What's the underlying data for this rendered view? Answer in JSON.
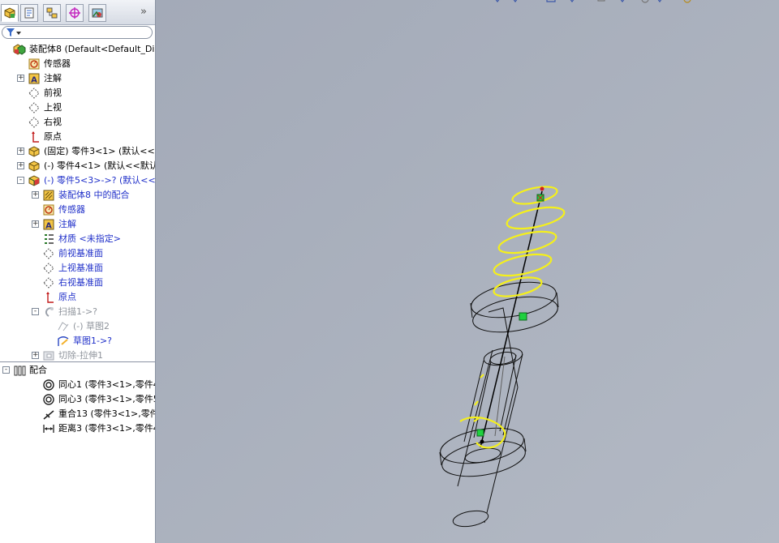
{
  "colors": {
    "viewport_bg": "#a7aebb",
    "spring": "#f5f01a",
    "selected_text": "#1f2fc9",
    "mate_point": "#1fd13f"
  },
  "tabs": [
    {
      "icon": "feature-manager-icon",
      "active": true
    },
    {
      "icon": "property-manager-icon",
      "active": false
    },
    {
      "icon": "configuration-manager-icon",
      "active": false
    },
    {
      "icon": "dimxpert-manager-icon",
      "active": false
    },
    {
      "icon": "display-manager-icon",
      "active": false
    }
  ],
  "more_label": "»",
  "tree": [
    {
      "label": "装配体8  (Default<Default_Di",
      "icon": "assembly-icon",
      "level": 0,
      "expander": ""
    },
    {
      "label": "传感器",
      "icon": "sensor-icon",
      "level": 1,
      "expander": ""
    },
    {
      "label": "注解",
      "icon": "annotation-icon",
      "level": 1,
      "expander": "+"
    },
    {
      "label": "前视",
      "icon": "plane-icon",
      "level": 1,
      "expander": ""
    },
    {
      "label": "上视",
      "icon": "plane-icon",
      "level": 1,
      "expander": ""
    },
    {
      "label": "右视",
      "icon": "plane-icon",
      "level": 1,
      "expander": ""
    },
    {
      "label": "原点",
      "icon": "origin-icon",
      "level": 1,
      "expander": ""
    },
    {
      "label": "(固定) 零件3<1> (默认<<默",
      "icon": "part-icon",
      "level": 1,
      "expander": "+"
    },
    {
      "label": "(-) 零件4<1> (默认<<默认>",
      "icon": "part-icon",
      "level": 1,
      "expander": "+"
    },
    {
      "label": "(-) 零件5<3>->? (默认<<默",
      "icon": "part-edit-icon",
      "level": 1,
      "expander": "-",
      "style": "blue"
    },
    {
      "label": "装配体8 中的配合",
      "icon": "mates-in-assembly-icon",
      "level": 2,
      "expander": "+",
      "style": "blue"
    },
    {
      "label": "传感器",
      "icon": "sensor-icon",
      "level": 2,
      "expander": "",
      "style": "blue"
    },
    {
      "label": "注解",
      "icon": "annotation-icon",
      "level": 2,
      "expander": "+",
      "style": "blue"
    },
    {
      "label": "材质 <未指定>",
      "icon": "material-icon",
      "level": 2,
      "expander": "",
      "style": "blue"
    },
    {
      "label": "前视基准面",
      "icon": "plane-icon",
      "level": 2,
      "expander": "",
      "style": "blue"
    },
    {
      "label": "上视基准面",
      "icon": "plane-icon",
      "level": 2,
      "expander": "",
      "style": "blue"
    },
    {
      "label": "右视基准面",
      "icon": "plane-icon",
      "level": 2,
      "expander": "",
      "style": "blue"
    },
    {
      "label": "原点",
      "icon": "origin-icon",
      "level": 2,
      "expander": "",
      "style": "blue"
    },
    {
      "label": "扫描1->?",
      "icon": "sweep-icon",
      "level": 2,
      "expander": "-",
      "style": "gray"
    },
    {
      "label": "(-) 草图2",
      "icon": "sketch-icon",
      "level": 3,
      "expander": "",
      "style": "gray"
    },
    {
      "label": "草图1->?",
      "icon": "sketch-active-icon",
      "level": 3,
      "expander": "",
      "style": "blue"
    },
    {
      "label": "切除-拉伸1",
      "icon": "cut-extrude-icon",
      "level": 2,
      "expander": "+",
      "style": "gray"
    },
    {
      "label": "配合",
      "icon": "mates-icon",
      "level": 0,
      "expander": "-"
    },
    {
      "label": "同心1 (零件3<1>,零件4<",
      "icon": "concentric-icon",
      "level": 2,
      "expander": ""
    },
    {
      "label": "同心3 (零件3<1>,零件5<",
      "icon": "concentric-icon",
      "level": 2,
      "expander": ""
    },
    {
      "label": "重合13 (零件3<1>,零件5",
      "icon": "coincident-icon",
      "level": 2,
      "expander": ""
    },
    {
      "label": "距离3 (零件3<1>,零件4<",
      "icon": "distance-icon",
      "level": 2,
      "expander": ""
    }
  ]
}
